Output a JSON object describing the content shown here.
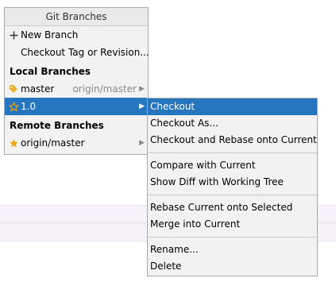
{
  "popup": {
    "title": "Git Branches",
    "actions": [
      {
        "icon": "plus-icon",
        "label": "New Branch"
      },
      {
        "icon": "",
        "label": "Checkout Tag or Revision..."
      }
    ],
    "local_section": "Local Branches",
    "local_branches": [
      {
        "icon": "tag-icon",
        "name": "master",
        "tracking": "origin/master"
      },
      {
        "icon": "star-outline-icon",
        "name": "1.0",
        "tracking": ""
      }
    ],
    "remote_section": "Remote Branches",
    "remote_branches": [
      {
        "icon": "star-filled-icon",
        "name": "origin/master"
      }
    ]
  },
  "submenu": {
    "groups": [
      [
        "Checkout",
        "Checkout As...",
        "Checkout and Rebase onto Current"
      ],
      [
        "Compare with Current",
        "Show Diff with Working Tree"
      ],
      [
        "Rebase Current onto Selected",
        "Merge into Current"
      ],
      [
        "Rename...",
        "Delete"
      ]
    ]
  },
  "colors": {
    "selection": "#2675bf",
    "tag_icon": "#e9b233",
    "star_icon": "#f0a818"
  }
}
